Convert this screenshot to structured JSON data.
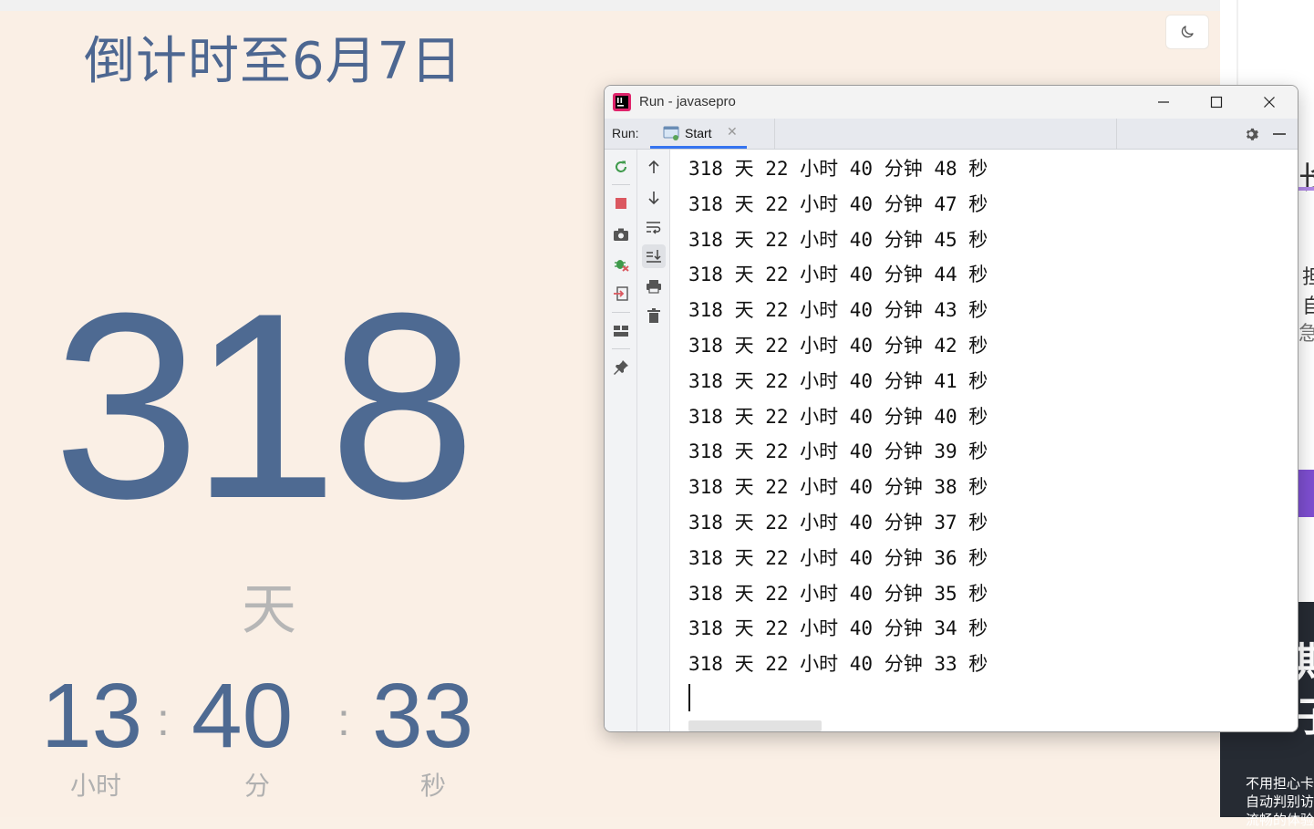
{
  "countdown": {
    "title": "倒计时至6月7日",
    "days": "318",
    "days_unit": "天",
    "hours": "13",
    "minutes": "40",
    "seconds": "33",
    "separator": ":",
    "hours_label": "小时",
    "minutes_label": "分",
    "seconds_label": "秒",
    "theme_toggle_icon": "moon-icon"
  },
  "ide": {
    "window_title": "Run - javasepro",
    "run_label": "Run:",
    "tab_label": "Start",
    "console_lines": [
      "318 天 22 小时 40 分钟 48 秒",
      "318 天 22 小时 40 分钟 47 秒",
      "318 天 22 小时 40 分钟 45 秒",
      "318 天 22 小时 40 分钟 44 秒",
      "318 天 22 小时 40 分钟 43 秒",
      "318 天 22 小时 40 分钟 42 秒",
      "318 天 22 小时 40 分钟 41 秒",
      "318 天 22 小时 40 分钟 40 秒",
      "318 天 22 小时 40 分钟 39 秒",
      "318 天 22 小时 40 分钟 38 秒",
      "318 天 22 小时 40 分钟 37 秒",
      "318 天 22 小时 40 分钟 36 秒",
      "318 天 22 小时 40 分钟 35 秒",
      "318 天 22 小时 40 分钟 34 秒",
      "318 天 22 小时 40 分钟 33 秒"
    ],
    "left_tools": [
      "rerun-icon",
      "stop-icon",
      "camera-icon",
      "debug-icon",
      "exit-icon",
      "layout-icon",
      "pin-icon"
    ],
    "right_tools": [
      "up-arrow-icon",
      "down-arrow-icon",
      "soft-wrap-icon",
      "scroll-to-end-icon",
      "print-icon",
      "trash-icon"
    ]
  },
  "background_right": {
    "glyphs": [
      "长",
      "担",
      "自",
      "急",
      "期",
      "子"
    ],
    "dark_text": [
      "不用担心卡",
      "自动判别访",
      "流畅的体验"
    ]
  }
}
